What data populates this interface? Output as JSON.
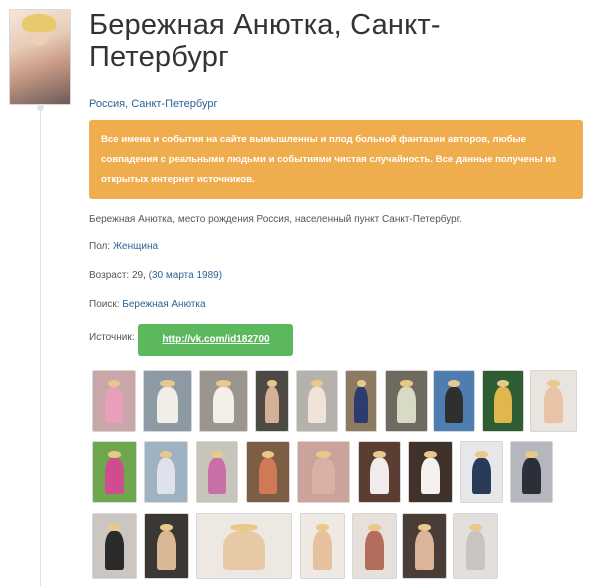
{
  "profile": {
    "title": "Бережная Анютка, Санкт-Петербург",
    "title_line1": "Бережная Анютка, Санкт-",
    "title_line2": "Петербург",
    "country": "Россия",
    "separator": ", ",
    "city": "Санкт-Петербург",
    "disclaimer": "Все имена и события на сайте вымышленны и плод больной фантазии авторов, любые совпадения с реальными людьми и событиями чистая случайность. Все данные получены из открытых интернет источников.",
    "description": "Бережная Анютка, место рождения Россия, населенный пункт Санкт-Петербург.",
    "gender_label": "Пол:",
    "gender_value": "Женщина",
    "age_label": "Возраст: 29,",
    "age_date": "(30 марта 1989)",
    "search_label": "Поиск:",
    "search_value": "Бережная Анютка",
    "source_label": "Источник:",
    "source_link": "http://vk.com/id182700"
  },
  "colors": {
    "warning_bg": "#f0ad4e",
    "success_bg": "#5cb85c",
    "link": "#2a6496"
  },
  "photos": [
    {
      "bg": "#c9a7a9",
      "body": "#e99fb9"
    },
    {
      "bg": "#8e9aa3",
      "body": "#f1ede7"
    },
    {
      "bg": "#9a958e",
      "body": "#f3efe8"
    },
    {
      "bg": "#4d4a46",
      "body": "#d4b196"
    },
    {
      "bg": "#b5b1ad",
      "body": "#f0e4d8"
    },
    {
      "bg": "#8c7b60",
      "body": "#2c3c6e"
    },
    {
      "bg": "#6f6a60",
      "body": "#d8dac5"
    },
    {
      "bg": "#4e7eb0",
      "body": "#2f2f2f"
    },
    {
      "bg": "#2f5d33",
      "body": "#e0b74c"
    },
    {
      "bg": "#e9e4de",
      "body": "#e8c3a6"
    },
    {
      "bg": "#6fa74e",
      "body": "#d04c8e"
    },
    {
      "bg": "#9fb2c2",
      "body": "#dfe2ea"
    },
    {
      "bg": "#c7c5ba",
      "body": "#c86fa6"
    },
    {
      "bg": "#7e5d45",
      "body": "#cf7a54"
    },
    {
      "bg": "#caa39a",
      "body": "#d9b1a5"
    },
    {
      "bg": "#5b3d33",
      "body": "#f0eceb"
    },
    {
      "bg": "#403229",
      "body": "#f4f1ee"
    },
    {
      "bg": "#e5e7ea",
      "body": "#2a3b5a"
    },
    {
      "bg": "#b4b8bd",
      "body": "#2b2f3a"
    },
    {
      "bg": "#cbc6c2",
      "body": "#2a2a2a"
    },
    {
      "bg": "#3b3733",
      "body": "#d9b896"
    },
    {
      "bg": "#eee8e3",
      "body": "#e8c9a5"
    },
    {
      "bg": "#efe9e4",
      "body": "#e6c1a0"
    },
    {
      "bg": "#e6dfda",
      "body": "#b46c5d"
    },
    {
      "bg": "#4a3d37",
      "body": "#dbb49a"
    },
    {
      "bg": "#e3dfdc",
      "body": "#c9c4c0"
    }
  ]
}
